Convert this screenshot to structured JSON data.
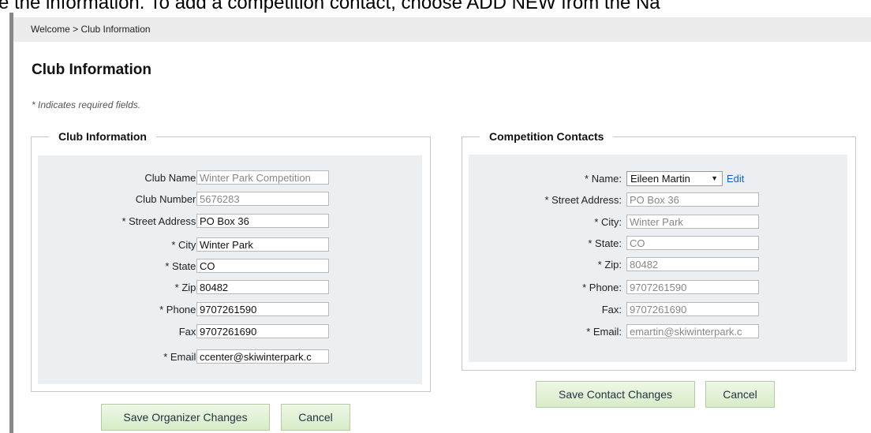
{
  "overlay_caption": "e the information. To add a competition contact, choose ADD NEW from the Na",
  "breadcrumb": {
    "home": "Welcome",
    "separator": ">",
    "current": "Club Information"
  },
  "page_title": "Club Information",
  "required_note": "* Indicates required fields.",
  "club_info": {
    "legend": "Club Information",
    "fields": [
      {
        "label": "Club Name:",
        "value": "Winter Park Competition",
        "readonly": true
      },
      {
        "label": "Club Number:",
        "value": "5676283",
        "readonly": true
      },
      {
        "label": "* Street Address:",
        "value": "PO Box 36",
        "readonly": false
      },
      {
        "label": "* City:",
        "value": "Winter Park",
        "readonly": false
      },
      {
        "label": "* State:",
        "value": "CO",
        "readonly": false
      },
      {
        "label": "* Zip:",
        "value": "80482",
        "readonly": false
      },
      {
        "label": "* Phone:",
        "value": "9707261590",
        "readonly": false
      },
      {
        "label": "Fax:",
        "value": "9707261690",
        "readonly": false
      },
      {
        "label": "* Email:",
        "value": "ccenter@skiwinterpark.c",
        "readonly": false
      }
    ],
    "save_label": "Save Organizer Changes",
    "cancel_label": "Cancel"
  },
  "contacts": {
    "legend": "Competition Contacts",
    "name_label": "* Name:",
    "name_selected": "Eileen Martin",
    "edit_label": "Edit",
    "fields": [
      {
        "label": "* Street Address:",
        "value": "PO Box 36"
      },
      {
        "label": "* City:",
        "value": "Winter Park"
      },
      {
        "label": "* State:",
        "value": "CO"
      },
      {
        "label": "* Zip:",
        "value": "80482"
      },
      {
        "label": "* Phone:",
        "value": "9707261590"
      },
      {
        "label": "Fax:",
        "value": "9707261690"
      },
      {
        "label": "* Email:",
        "value": "emartin@skiwinterpark.c"
      }
    ],
    "save_label": "Save Contact Changes",
    "cancel_label": "Cancel"
  },
  "colors": {
    "panel_bg": "#eceff1",
    "button_bg": "#dcefcd",
    "link": "#1a5fd1"
  }
}
